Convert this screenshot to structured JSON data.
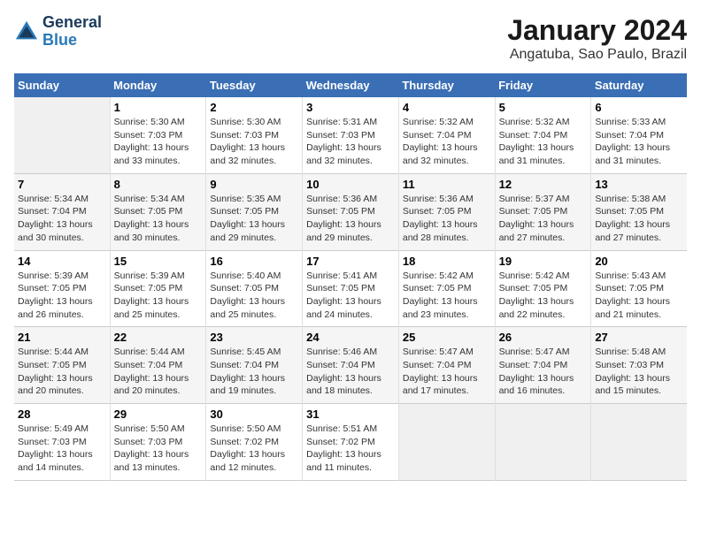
{
  "header": {
    "logo_line1": "General",
    "logo_line2": "Blue",
    "main_title": "January 2024",
    "subtitle": "Angatuba, Sao Paulo, Brazil"
  },
  "calendar": {
    "days_of_week": [
      "Sunday",
      "Monday",
      "Tuesday",
      "Wednesday",
      "Thursday",
      "Friday",
      "Saturday"
    ],
    "weeks": [
      [
        {
          "day": "",
          "info": ""
        },
        {
          "day": "1",
          "info": "Sunrise: 5:30 AM\nSunset: 7:03 PM\nDaylight: 13 hours\nand 33 minutes."
        },
        {
          "day": "2",
          "info": "Sunrise: 5:30 AM\nSunset: 7:03 PM\nDaylight: 13 hours\nand 32 minutes."
        },
        {
          "day": "3",
          "info": "Sunrise: 5:31 AM\nSunset: 7:03 PM\nDaylight: 13 hours\nand 32 minutes."
        },
        {
          "day": "4",
          "info": "Sunrise: 5:32 AM\nSunset: 7:04 PM\nDaylight: 13 hours\nand 32 minutes."
        },
        {
          "day": "5",
          "info": "Sunrise: 5:32 AM\nSunset: 7:04 PM\nDaylight: 13 hours\nand 31 minutes."
        },
        {
          "day": "6",
          "info": "Sunrise: 5:33 AM\nSunset: 7:04 PM\nDaylight: 13 hours\nand 31 minutes."
        }
      ],
      [
        {
          "day": "7",
          "info": "Sunrise: 5:34 AM\nSunset: 7:04 PM\nDaylight: 13 hours\nand 30 minutes."
        },
        {
          "day": "8",
          "info": "Sunrise: 5:34 AM\nSunset: 7:05 PM\nDaylight: 13 hours\nand 30 minutes."
        },
        {
          "day": "9",
          "info": "Sunrise: 5:35 AM\nSunset: 7:05 PM\nDaylight: 13 hours\nand 29 minutes."
        },
        {
          "day": "10",
          "info": "Sunrise: 5:36 AM\nSunset: 7:05 PM\nDaylight: 13 hours\nand 29 minutes."
        },
        {
          "day": "11",
          "info": "Sunrise: 5:36 AM\nSunset: 7:05 PM\nDaylight: 13 hours\nand 28 minutes."
        },
        {
          "day": "12",
          "info": "Sunrise: 5:37 AM\nSunset: 7:05 PM\nDaylight: 13 hours\nand 27 minutes."
        },
        {
          "day": "13",
          "info": "Sunrise: 5:38 AM\nSunset: 7:05 PM\nDaylight: 13 hours\nand 27 minutes."
        }
      ],
      [
        {
          "day": "14",
          "info": "Sunrise: 5:39 AM\nSunset: 7:05 PM\nDaylight: 13 hours\nand 26 minutes."
        },
        {
          "day": "15",
          "info": "Sunrise: 5:39 AM\nSunset: 7:05 PM\nDaylight: 13 hours\nand 25 minutes."
        },
        {
          "day": "16",
          "info": "Sunrise: 5:40 AM\nSunset: 7:05 PM\nDaylight: 13 hours\nand 25 minutes."
        },
        {
          "day": "17",
          "info": "Sunrise: 5:41 AM\nSunset: 7:05 PM\nDaylight: 13 hours\nand 24 minutes."
        },
        {
          "day": "18",
          "info": "Sunrise: 5:42 AM\nSunset: 7:05 PM\nDaylight: 13 hours\nand 23 minutes."
        },
        {
          "day": "19",
          "info": "Sunrise: 5:42 AM\nSunset: 7:05 PM\nDaylight: 13 hours\nand 22 minutes."
        },
        {
          "day": "20",
          "info": "Sunrise: 5:43 AM\nSunset: 7:05 PM\nDaylight: 13 hours\nand 21 minutes."
        }
      ],
      [
        {
          "day": "21",
          "info": "Sunrise: 5:44 AM\nSunset: 7:05 PM\nDaylight: 13 hours\nand 20 minutes."
        },
        {
          "day": "22",
          "info": "Sunrise: 5:44 AM\nSunset: 7:04 PM\nDaylight: 13 hours\nand 20 minutes."
        },
        {
          "day": "23",
          "info": "Sunrise: 5:45 AM\nSunset: 7:04 PM\nDaylight: 13 hours\nand 19 minutes."
        },
        {
          "day": "24",
          "info": "Sunrise: 5:46 AM\nSunset: 7:04 PM\nDaylight: 13 hours\nand 18 minutes."
        },
        {
          "day": "25",
          "info": "Sunrise: 5:47 AM\nSunset: 7:04 PM\nDaylight: 13 hours\nand 17 minutes."
        },
        {
          "day": "26",
          "info": "Sunrise: 5:47 AM\nSunset: 7:04 PM\nDaylight: 13 hours\nand 16 minutes."
        },
        {
          "day": "27",
          "info": "Sunrise: 5:48 AM\nSunset: 7:03 PM\nDaylight: 13 hours\nand 15 minutes."
        }
      ],
      [
        {
          "day": "28",
          "info": "Sunrise: 5:49 AM\nSunset: 7:03 PM\nDaylight: 13 hours\nand 14 minutes."
        },
        {
          "day": "29",
          "info": "Sunrise: 5:50 AM\nSunset: 7:03 PM\nDaylight: 13 hours\nand 13 minutes."
        },
        {
          "day": "30",
          "info": "Sunrise: 5:50 AM\nSunset: 7:02 PM\nDaylight: 13 hours\nand 12 minutes."
        },
        {
          "day": "31",
          "info": "Sunrise: 5:51 AM\nSunset: 7:02 PM\nDaylight: 13 hours\nand 11 minutes."
        },
        {
          "day": "",
          "info": ""
        },
        {
          "day": "",
          "info": ""
        },
        {
          "day": "",
          "info": ""
        }
      ]
    ]
  }
}
